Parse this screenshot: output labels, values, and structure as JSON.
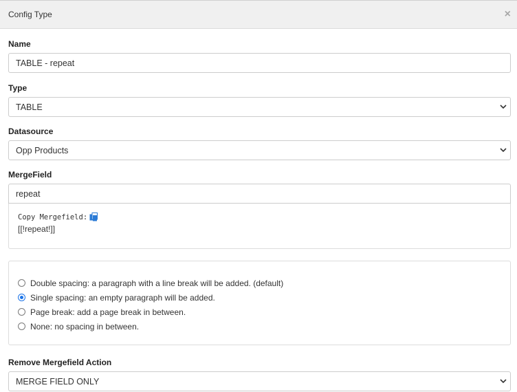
{
  "modal": {
    "title": "Config Type",
    "close_glyph": "×"
  },
  "fields": {
    "name": {
      "label": "Name",
      "value": "TABLE - repeat"
    },
    "type": {
      "label": "Type",
      "selected": "TABLE"
    },
    "datasource": {
      "label": "Datasource",
      "selected": "Opp Products"
    },
    "mergefield": {
      "label": "MergeField",
      "value": "repeat",
      "copy_label": "Copy Mergefield:",
      "copy_icon": "copy-icon",
      "merge_value": "[[!repeat!]]"
    },
    "spacing": {
      "options": [
        {
          "label": "Double spacing: a paragraph with a line break will be added. (default)",
          "checked": false
        },
        {
          "label": "Single spacing: an empty paragraph will be added.",
          "checked": true
        },
        {
          "label": "Page break: add a page break in between.",
          "checked": false
        },
        {
          "label": "None: no spacing in between.",
          "checked": false
        }
      ]
    },
    "remove_action": {
      "label": "Remove Mergefield Action",
      "selected": "MERGE FIELD ONLY"
    }
  },
  "colors": {
    "accent": "#1a73e8",
    "header_bg": "#f0f0f0"
  }
}
